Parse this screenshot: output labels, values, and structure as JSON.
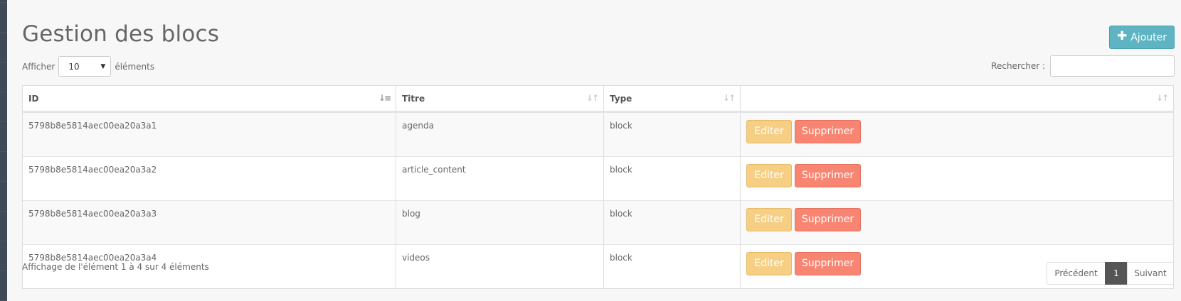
{
  "page": {
    "title": "Gestion des blocs",
    "add_button_label": "Ajouter",
    "add_icon": "plus-icon"
  },
  "length_control": {
    "prefix": "Afficher",
    "selected": "10",
    "suffix": "éléments"
  },
  "search": {
    "label": "Rechercher :",
    "value": ""
  },
  "table": {
    "headers": [
      "ID",
      "Titre",
      "Type",
      ""
    ],
    "sorted_column": "ID",
    "edit_label": "Editer",
    "delete_label": "Supprimer",
    "rows": [
      {
        "id": "5798b8e5814aec00ea20a3a1",
        "title": "agenda",
        "type": "block"
      },
      {
        "id": "5798b8e5814aec00ea20a3a2",
        "title": "article_content",
        "type": "block"
      },
      {
        "id": "5798b8e5814aec00ea20a3a3",
        "title": "blog",
        "type": "block"
      },
      {
        "id": "5798b8e5814aec00ea20a3a4",
        "title": "videos",
        "type": "block"
      }
    ]
  },
  "footer": {
    "info": "Affichage de l'élément 1 à 4 sur 4 éléments",
    "prev_label": "Précédent",
    "current_page": "1",
    "next_label": "Suivant"
  },
  "colors": {
    "add_button": "#5eb4c2",
    "edit_button": "#f6cf85",
    "delete_button": "#f88572",
    "active_page": "#555555"
  }
}
